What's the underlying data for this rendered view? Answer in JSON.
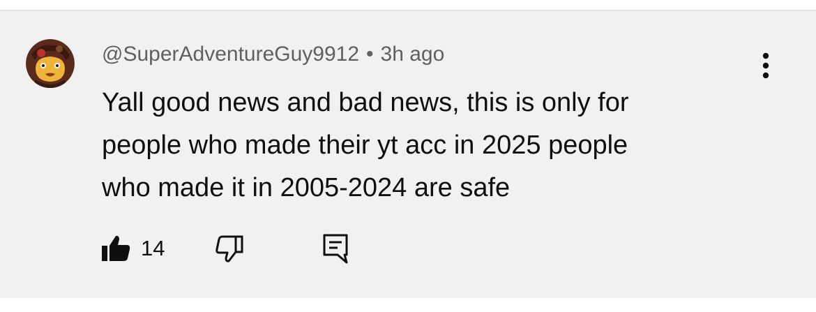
{
  "comment": {
    "author_handle": "@SuperAdventureGuy9912",
    "separator": "•",
    "time_ago": "3h ago",
    "text_lines": [
      "Yall good news and bad news, this is only for",
      "people who made their yt acc in 2025 people",
      "who made it in 2005-2024 are safe"
    ],
    "like_count": "14"
  },
  "icons": {
    "avatar": "cartoon-face-avatar",
    "menu": "vertical-dots-icon",
    "like": "thumbs-up-filled-icon",
    "dislike": "thumbs-down-outline-icon",
    "reply": "comment-reply-icon"
  },
  "colors": {
    "card_background": "#f1f1f1",
    "text_primary": "#0f0f0f",
    "text_secondary": "#606060"
  }
}
